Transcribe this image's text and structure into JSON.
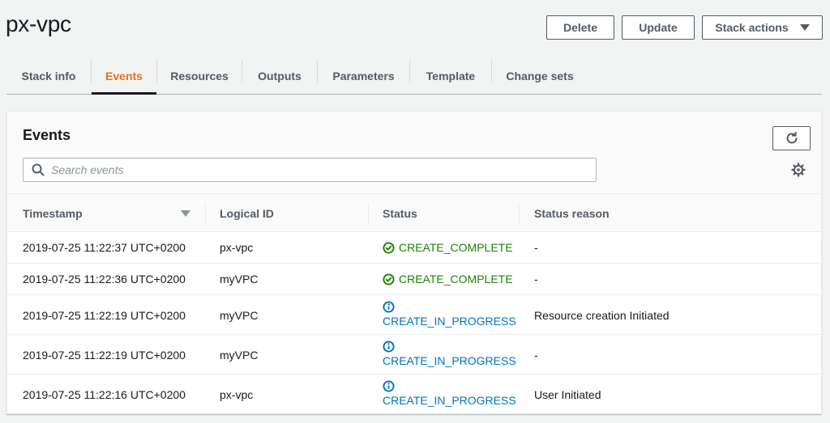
{
  "header": {
    "title": "px-vpc",
    "buttons": {
      "delete": "Delete",
      "update": "Update",
      "stack_actions": "Stack actions"
    }
  },
  "tabs": [
    {
      "label": "Stack info",
      "active": false
    },
    {
      "label": "Events",
      "active": true
    },
    {
      "label": "Resources",
      "active": false
    },
    {
      "label": "Outputs",
      "active": false
    },
    {
      "label": "Parameters",
      "active": false
    },
    {
      "label": "Template",
      "active": false
    },
    {
      "label": "Change sets",
      "active": false
    }
  ],
  "events": {
    "title": "Events",
    "search_placeholder": "Search events",
    "columns": [
      "Timestamp",
      "Logical ID",
      "Status",
      "Status reason"
    ],
    "rows": [
      {
        "timestamp": "2019-07-25 11:22:37 UTC+0200",
        "logical_id": "px-vpc",
        "status": "CREATE_COMPLETE",
        "status_type": "complete",
        "reason": "-"
      },
      {
        "timestamp": "2019-07-25 11:22:36 UTC+0200",
        "logical_id": "myVPC",
        "status": "CREATE_COMPLETE",
        "status_type": "complete",
        "reason": "-"
      },
      {
        "timestamp": "2019-07-25 11:22:19 UTC+0200",
        "logical_id": "myVPC",
        "status": "CREATE_IN_PROGRESS",
        "status_type": "in-progress",
        "reason": "Resource creation Initiated"
      },
      {
        "timestamp": "2019-07-25 11:22:19 UTC+0200",
        "logical_id": "myVPC",
        "status": "CREATE_IN_PROGRESS",
        "status_type": "in-progress",
        "reason": "-"
      },
      {
        "timestamp": "2019-07-25 11:22:16 UTC+0200",
        "logical_id": "px-vpc",
        "status": "CREATE_IN_PROGRESS",
        "status_type": "in-progress",
        "reason": "User Initiated"
      }
    ]
  },
  "colors": {
    "active_tab": "#ec7211",
    "status_complete": "#1d8102",
    "status_in_progress": "#0073bb",
    "button_border": "#545b64"
  },
  "icons": {
    "stack_actions": "caret-down-icon",
    "refresh": "refresh-icon",
    "search": "search-icon",
    "settings": "gear-icon",
    "sort": "sort-desc-icon",
    "complete": "check-circle-icon",
    "in_progress": "info-circle-icon"
  }
}
